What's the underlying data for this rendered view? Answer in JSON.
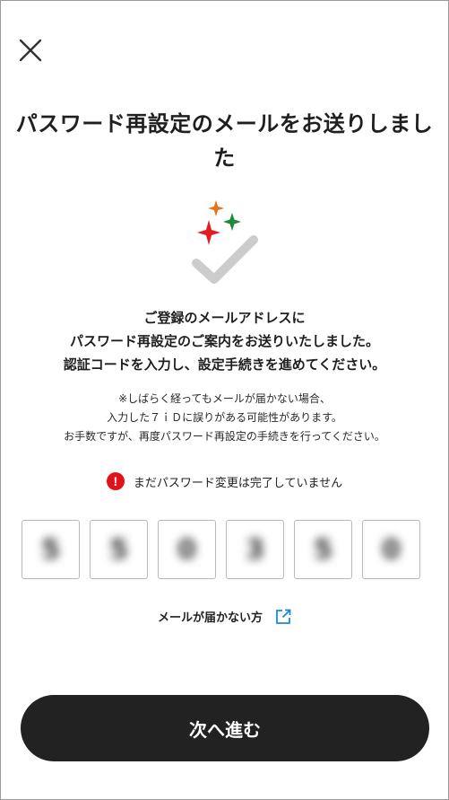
{
  "header": {
    "close_icon": "close-icon"
  },
  "title": {
    "line1": "パスワード再設定のメールをお送りしまし",
    "line2": "た"
  },
  "illustration": {
    "icon": "check-with-sparkles-icon",
    "check_color": "#cccccc",
    "sparkle_colors": [
      "#e8731a",
      "#1e8b3a",
      "#e31b23"
    ]
  },
  "description": {
    "line1": "ご登録のメールアドレスに",
    "line2": "パスワード再設定のご案内をお送りいたしました。",
    "line3": "認証コードを入力し、設定手続きを進めてください。"
  },
  "note": {
    "line1": "※しばらく経ってもメールが届かない場合、",
    "line2": "入力した７ｉＤに誤りがある可能性があります。",
    "line3": "お手数ですが、再度パスワード再設定の手続きを行ってください。"
  },
  "status": {
    "icon": "exclamation-icon",
    "icon_color": "#e0121b",
    "text": "まだパスワード変更は完了していません"
  },
  "code_inputs": [
    "5",
    "5",
    "0",
    "3",
    "5",
    "0"
  ],
  "help_link": {
    "text": "メールが届かない方",
    "icon": "external-link-icon",
    "icon_color": "#1a8ad4"
  },
  "next_button": {
    "label": "次へ進む",
    "bg_color": "#222222"
  }
}
